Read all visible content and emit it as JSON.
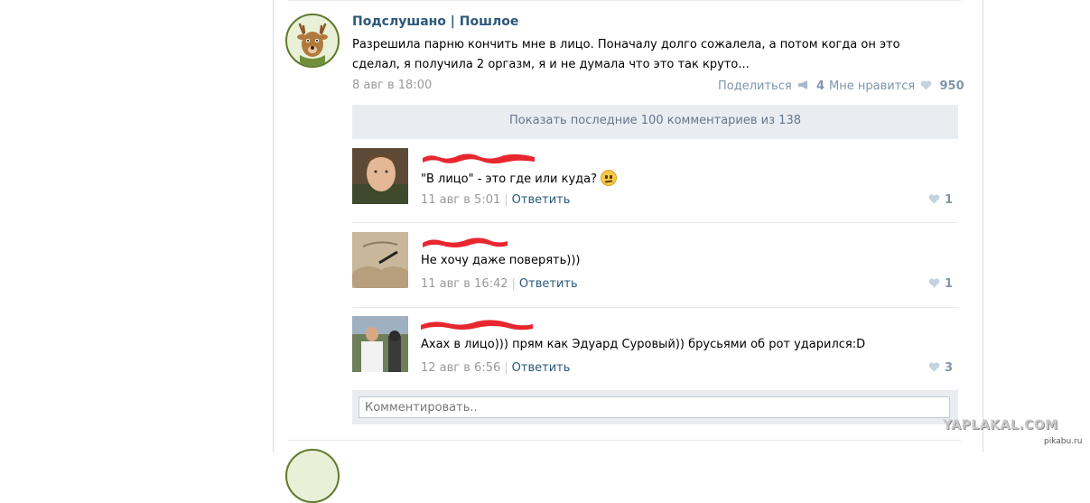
{
  "post": {
    "group_name": "Подслушано | Пошлое",
    "text": "Разрешила парню кончить мне в лицо. Поначалу долго сожалела, а потом когда он это сделал, я получила 2 оргазм, я и не думала что это так круто...",
    "date": "8 авг в 18:00",
    "share_label": "Поделиться",
    "share_count": "4",
    "like_label": "Мне нравится",
    "like_count": "950"
  },
  "show_more_label": "Показать последние 100 комментариев из 138",
  "comments": [
    {
      "text": "\"В лицо\" - это где или куда?",
      "date": "11 авг в 5:01",
      "reply_label": "Ответить",
      "likes": "1"
    },
    {
      "text": "Не хочу даже поверять)))",
      "date": "11 авг в 16:42",
      "reply_label": "Ответить",
      "likes": "1"
    },
    {
      "text": "Ахах в лицо))) прям как Эдуард Суровый)) брусьями об рот ударился:D",
      "date": "12 авг в 6:56",
      "reply_label": "Ответить",
      "likes": "3"
    }
  ],
  "comment_box": {
    "placeholder": "Комментировать.."
  },
  "watermarks": {
    "main": "YAPLAKAL.COM",
    "small": "pikabu.ru"
  },
  "colors": {
    "link": "#2b587a",
    "meta": "#7f95ad",
    "panel": "#e9edf1",
    "redaction": "#e8262e"
  },
  "icons": {
    "share": "megaphone-icon",
    "like": "heart-icon",
    "emoji": "confused-face-emoji"
  }
}
